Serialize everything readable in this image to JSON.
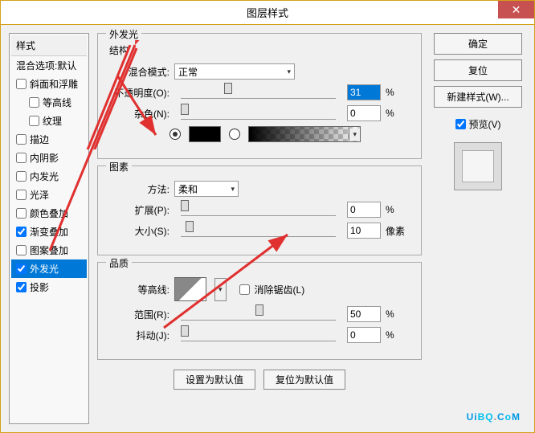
{
  "title": "图层样式",
  "left": {
    "header": "样式",
    "blend_default": "混合选项:默认",
    "items": [
      {
        "label": "斜面和浮雕",
        "checked": false,
        "indent": 0
      },
      {
        "label": "等高线",
        "checked": false,
        "indent": 1
      },
      {
        "label": "纹理",
        "checked": false,
        "indent": 1
      },
      {
        "label": "描边",
        "checked": false,
        "indent": 0
      },
      {
        "label": "内阴影",
        "checked": false,
        "indent": 0
      },
      {
        "label": "内发光",
        "checked": false,
        "indent": 0
      },
      {
        "label": "光泽",
        "checked": false,
        "indent": 0
      },
      {
        "label": "颜色叠加",
        "checked": false,
        "indent": 0
      },
      {
        "label": "渐变叠加",
        "checked": true,
        "indent": 0
      },
      {
        "label": "图案叠加",
        "checked": false,
        "indent": 0
      },
      {
        "label": "外发光",
        "checked": true,
        "indent": 0,
        "selected": true
      },
      {
        "label": "投影",
        "checked": true,
        "indent": 0
      }
    ]
  },
  "outer_glow": {
    "section": "外发光",
    "structure": {
      "title": "结构",
      "blend_mode_label": "混合模式:",
      "blend_mode_value": "正常",
      "opacity_label": "不透明度(O):",
      "opacity_value": "31",
      "opacity_unit": "%",
      "noise_label": "杂色(N):",
      "noise_value": "0",
      "noise_unit": "%",
      "color_solid": "#000000"
    },
    "elements": {
      "title": "图素",
      "technique_label": "方法:",
      "technique_value": "柔和",
      "spread_label": "扩展(P):",
      "spread_value": "0",
      "spread_unit": "%",
      "size_label": "大小(S):",
      "size_value": "10",
      "size_unit": "像素"
    },
    "quality": {
      "title": "品质",
      "contour_label": "等高线:",
      "antialias_label": "消除锯齿(L)",
      "range_label": "范围(R):",
      "range_value": "50",
      "range_unit": "%",
      "jitter_label": "抖动(J):",
      "jitter_value": "0",
      "jitter_unit": "%"
    },
    "buttons": {
      "default": "设置为默认值",
      "reset": "复位为默认值"
    }
  },
  "right": {
    "ok": "确定",
    "reset": "复位",
    "new_style": "新建样式(W)...",
    "preview": "预览(V)"
  },
  "watermark": {
    "t1": "U",
    "t2": "i",
    "t3": "B",
    "t4": "Q",
    "t5": ".",
    "t6": "C",
    "t7": "o",
    "t8": "M"
  }
}
